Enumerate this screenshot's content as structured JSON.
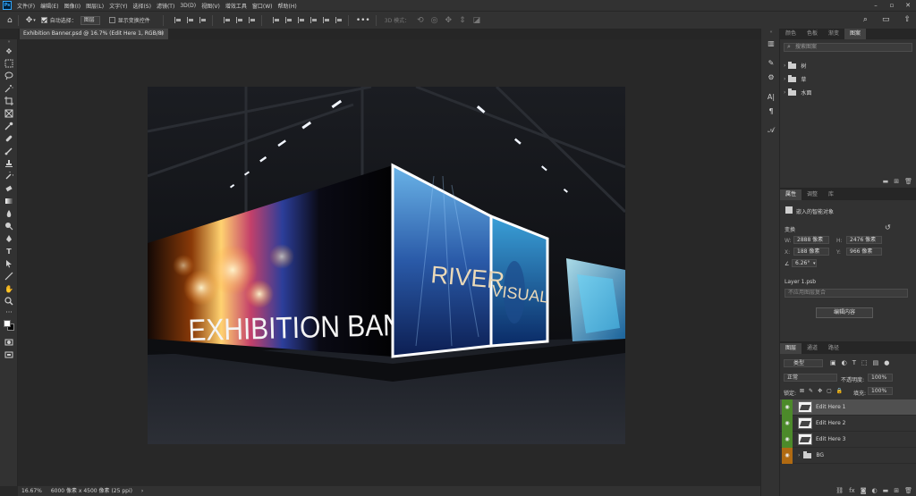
{
  "app": {
    "logo": "Ps",
    "menus": [
      "文件(F)",
      "编辑(E)",
      "图像(I)",
      "图层(L)",
      "文字(Y)",
      "选择(S)",
      "滤镜(T)",
      "3D(D)",
      "视图(V)",
      "增效工具",
      "窗口(W)",
      "帮助(H)"
    ]
  },
  "options_bar": {
    "auto_select_label": "自动选择：",
    "auto_select_value": "图层",
    "show_transform_label": "显示变换控件",
    "mode_3d_label": "3D 模式："
  },
  "document": {
    "tab_title": "Exhibition Banner.psd @ 16.7% (Edit Here 1, RGB/8)",
    "banner_text": "EXHIBITION BANNER",
    "river_text": "RIVER",
    "visual_text": "VISUAL"
  },
  "statusbar": {
    "zoom": "16.67%",
    "dimensions": "6000 像素 x 4500 像素 (25 ppi)"
  },
  "panel_top": {
    "tabs": [
      "颜色",
      "色板",
      "渐变",
      "图案"
    ],
    "active_tab": 3,
    "search_placeholder": "搜索图案",
    "groups": [
      "树",
      "草",
      "水面"
    ]
  },
  "properties": {
    "tabs": [
      "属性",
      "调整",
      "库"
    ],
    "active_tab": 0,
    "object_type": "嵌入的智能对象",
    "transform_label": "变换",
    "w_label": "W:",
    "w_value": "2888 像素",
    "h_label": "H:",
    "h_value": "2476 像素",
    "x_label": "X:",
    "x_value": "188 像素",
    "y_label": "Y:",
    "y_value": "966 像素",
    "angle": "6.26°",
    "linked_file": "Layer 1.psb",
    "layer_comp": "不应用图层复合",
    "edit_button": "编辑内容"
  },
  "layers": {
    "tabs": [
      "图层",
      "通道",
      "路径"
    ],
    "active_tab": 0,
    "filter_kind": "类型",
    "blend_mode": "正常",
    "opacity_label": "不透明度:",
    "opacity_value": "100%",
    "lock_label": "锁定:",
    "fill_label": "填充:",
    "fill_value": "100%",
    "items": [
      {
        "name": "Edit Here 1",
        "selected": true,
        "eye": "green",
        "type": "smart"
      },
      {
        "name": "Edit Here 2",
        "selected": false,
        "eye": "green",
        "type": "smart"
      },
      {
        "name": "Edit Here 3",
        "selected": false,
        "eye": "green",
        "type": "smart"
      },
      {
        "name": "BG",
        "selected": false,
        "eye": "orange",
        "type": "group"
      }
    ]
  }
}
